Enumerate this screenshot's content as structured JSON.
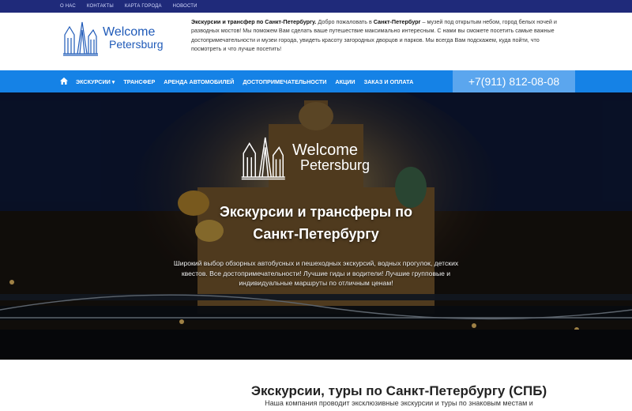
{
  "topbar": {
    "links": [
      "О НАС",
      "КОНТАКТЫ",
      "КАРТА ГОРОДА",
      "НОВОСТИ"
    ]
  },
  "logo": {
    "line1": "Welcome",
    "line2": "Petersburg"
  },
  "intro": {
    "bold1": "Экскурсии и трансфер по Санкт-Петербургу.",
    "text1": " Добро пожаловать в ",
    "bold2": "Санкт-Петербург",
    "text2": " – музей под открытым небом, город белых ночей и разводных мостов! Мы поможем Вам сделать ваше путешествие максимально интересным. С нами вы сможете посетить самые важные достопримечательности и музеи города, увидеть красоту загородных дворцов и парков. Мы всегда Вам подскажем, куда пойти, что посмотреть и что лучше посетить!"
  },
  "nav": {
    "home_icon": "home-icon",
    "items": [
      "ЭКСКУРСИИ ▾",
      "ТРАНСФЕР",
      "АРЕНДА АВТОМОБИЛЕЙ",
      "ДОСТОПРИМЕЧАТЕЛЬНОСТИ",
      "АКЦИИ",
      "ЗАКАЗ И ОПЛАТА"
    ],
    "phone": "+7(911) 812-08-08"
  },
  "hero": {
    "logo_line1": "Welcome",
    "logo_line2": "Petersburg",
    "title_bold": "Экскурсии",
    "title_rest": " и трансферы по",
    "title_line2": "Санкт-Петербургу",
    "description": "Широкий выбор обзорных автобусных и пешеходных экскурсий, водных прогулок, детских квестов. Все достопримечательности! Лучшие гиды и водители! Лучшие групповые и индивидуальные маршруты по отличным ценам!"
  },
  "section": {
    "title": "Экскурсии, туры по Санкт-Петербургу (СПБ)",
    "subtitle": "Наша компания проводит эксклюзивные экскурсии и туры по знаковым местам и"
  },
  "colors": {
    "topbar": "#1f2a7a",
    "nav": "#1582e6",
    "phone_bg": "#5ba6ee",
    "logo_blue": "#1f5ab8"
  }
}
